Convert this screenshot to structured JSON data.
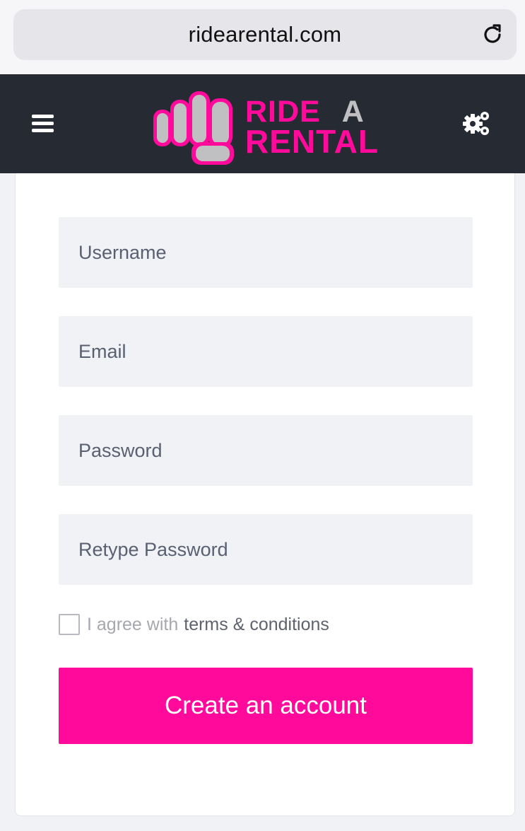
{
  "browser": {
    "url": "ridearental.com",
    "reload_icon": "reload-icon"
  },
  "header": {
    "menu_icon": "hamburger-menu-icon",
    "logo": {
      "line1_pink": "RIDE",
      "line1_grey": "A",
      "line2": "RENTAL"
    },
    "settings_icon": "gears-icon"
  },
  "form": {
    "username": {
      "placeholder": "Username",
      "value": ""
    },
    "email": {
      "placeholder": "Email",
      "value": ""
    },
    "password": {
      "placeholder": "Password",
      "value": ""
    },
    "retype_password": {
      "placeholder": "Retype Password",
      "value": ""
    },
    "agree": {
      "checked": false,
      "text": "I agree with",
      "link": "terms & conditions"
    },
    "submit_label": "Create an account"
  },
  "colors": {
    "brand_pink": "#ff0a9b",
    "header_bg": "#262b33",
    "page_bg": "#f1f2f5",
    "field_bg": "#f1f2f5"
  }
}
